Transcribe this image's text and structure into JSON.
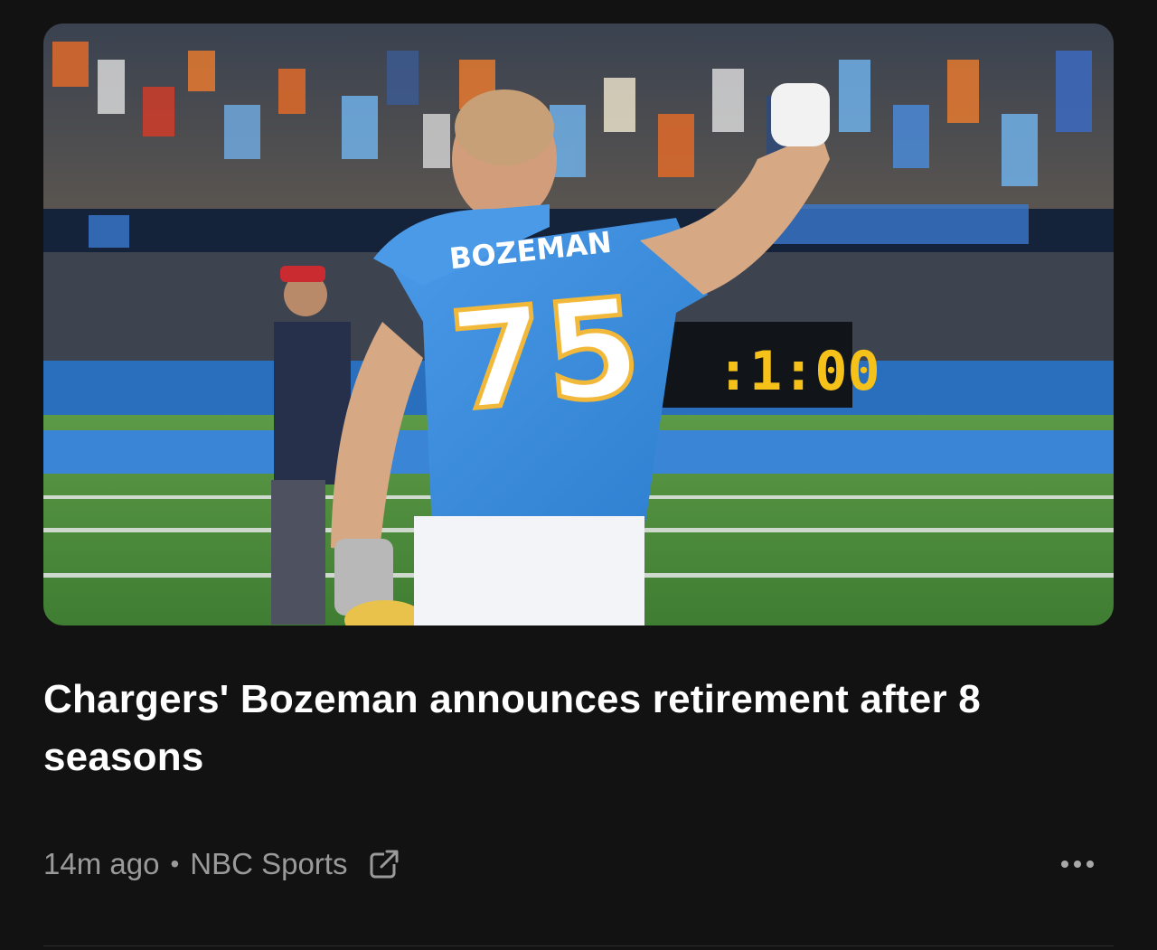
{
  "article": {
    "image_alt": "Chargers player in number 75 Bozeman jersey raising his fist on the field",
    "jersey_name": "BOZEMAN",
    "jersey_number": "75",
    "clock_text": ":1:00",
    "headline": "Chargers' Bozeman announces retirement after 8 seasons",
    "time_ago": "14m ago",
    "separator": "•",
    "source": "NBC Sports",
    "external_link_icon": "external-link-icon",
    "more_icon": "more-horizontal-icon"
  },
  "colors": {
    "background": "#121212",
    "headline": "#ffffff",
    "meta": "#9a9a9a",
    "jersey_blue": "#3e8fe0",
    "jersey_gold": "#f2b83a",
    "field_green": "#4a8a3c"
  }
}
